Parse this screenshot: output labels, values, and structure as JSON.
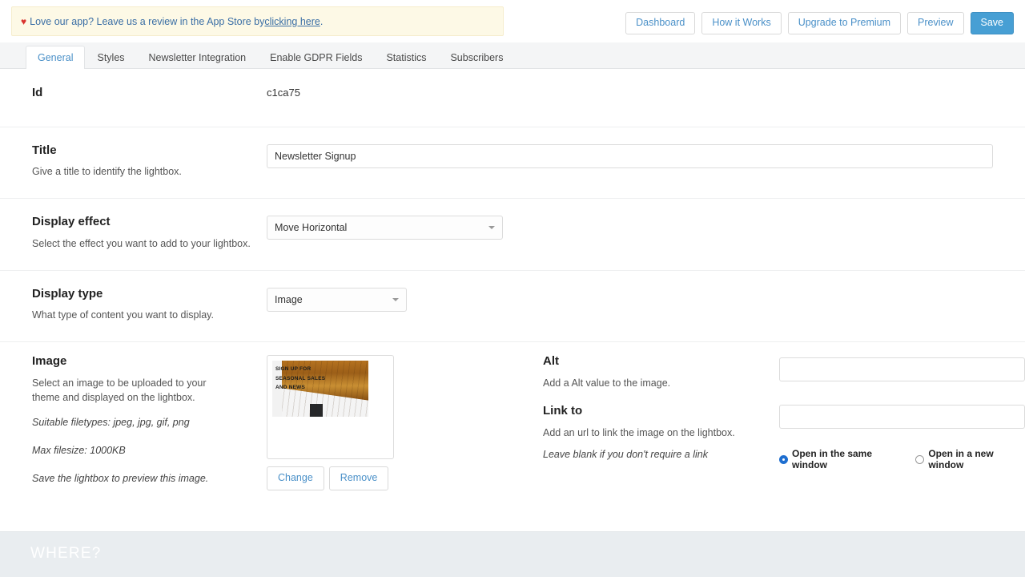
{
  "notice": {
    "icon": "heart-icon",
    "text_before": "Love our app? Leave us a review in the App Store by ",
    "link": "clicking here",
    "text_after": "."
  },
  "toolbar": {
    "buttons": [
      {
        "label": "Dashboard",
        "name": "dashboard-button",
        "primary": false
      },
      {
        "label": "How it Works",
        "name": "how-it-works-button",
        "primary": false
      },
      {
        "label": "Upgrade to Premium",
        "name": "upgrade-to-premium-button",
        "primary": false
      },
      {
        "label": "Preview",
        "name": "preview-button",
        "primary": false
      },
      {
        "label": "Save",
        "name": "save-button",
        "primary": true
      }
    ],
    "dashboard": "Dashboard",
    "how_it_works": "How it Works",
    "upgrade": "Upgrade to Premium",
    "preview": "Preview",
    "save": "Save"
  },
  "tabs": [
    {
      "label": "General",
      "active": true
    },
    {
      "label": "Styles",
      "active": false
    },
    {
      "label": "Newsletter Integration",
      "active": false
    },
    {
      "label": "Enable GDPR Fields",
      "active": false
    },
    {
      "label": "Statistics",
      "active": false
    },
    {
      "label": "Subscribers",
      "active": false
    }
  ],
  "sections": {
    "id": {
      "label": "Id",
      "value": "c1ca75"
    },
    "title": {
      "label": "Title",
      "help": "Give a title to identify the lightbox.",
      "value": "Newsletter Signup",
      "placeholder": ""
    },
    "display_effect": {
      "label": "Display effect",
      "help": "Select the effect you want to add to your lightbox.",
      "value": "Move Horizontal"
    },
    "display_type": {
      "label": "Display type",
      "help": "What type of content you want to display.",
      "value": "Image"
    },
    "image": {
      "label": "Image",
      "help": "Select an image to be uploaded to your theme and displayed on the lightbox.",
      "filetypes": "Suitable filetypes: jpeg, jpg, gif, png",
      "filesize": "Max filesize: 1000KB",
      "preview_note": "Save the lightbox to preview this image.",
      "thumbnail_text": "SIGN UP FOR\nSEASONAL SALES\nAND NEWS",
      "change_label": "Change",
      "remove_label": "Remove"
    },
    "alt": {
      "label": "Alt",
      "help": "Add a Alt value to the image.",
      "value": "",
      "placeholder": ""
    },
    "link_to": {
      "label": "Link to",
      "help": "Add an url to link the image on the lightbox.",
      "note": "Leave blank if you don't require a link",
      "value": "",
      "placeholder": "",
      "options": [
        {
          "label": "Open in the same window",
          "selected": true
        },
        {
          "label": "Open in a new window",
          "selected": false
        }
      ]
    }
  },
  "where_section": {
    "heading": "WHERE?"
  },
  "colors": {
    "accent": "#479fd4",
    "link": "#4a90c8",
    "notice_bg": "#fdf9e6",
    "notice_text": "#3a6ea5",
    "heart": "#d9332e",
    "radio_selected": "#1f6fd0",
    "where_band_bg": "#e9edf0",
    "where_heading": "#ffffff"
  }
}
